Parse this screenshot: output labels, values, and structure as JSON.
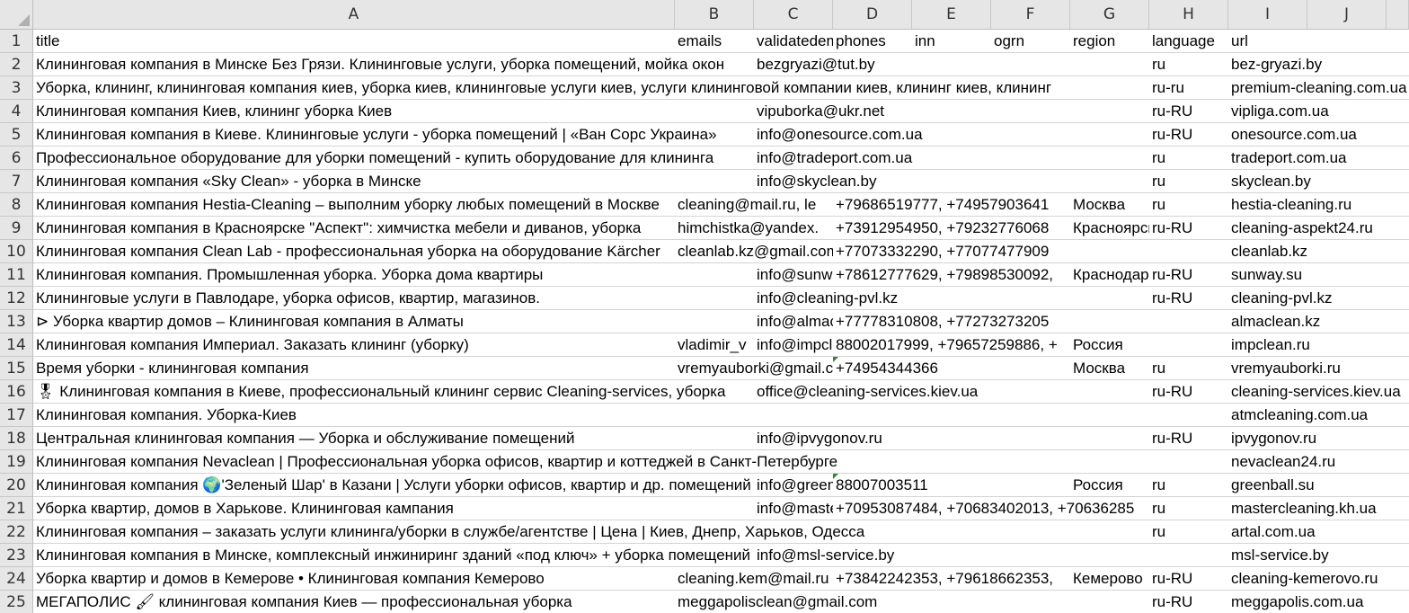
{
  "columns": [
    "A",
    "B",
    "C",
    "D",
    "E",
    "F",
    "G",
    "H",
    "I",
    "J"
  ],
  "rows": [
    [
      "title",
      "emails",
      "validatedemails",
      "phones",
      "inn",
      "ogrn",
      "region",
      "language",
      "url",
      ""
    ],
    [
      "Клининговая компания в Минске Без Грязи. Клининговые услуги, уборка помещений, мойка окон",
      "",
      "bezgryazi@tut.by",
      "",
      "",
      "",
      "",
      "ru",
      "bez-gryazi.by",
      ""
    ],
    [
      "Уборка, клининг, клининговая компания киев, уборка киев, клининговые услуги киев, услуги клининговой компании киев, клининг киев, клининг",
      "",
      "",
      "",
      "",
      "",
      "",
      "ru-ru",
      "premium-cleaning.com.ua",
      ""
    ],
    [
      "Клининговая компания Киев, клининг уборка Киев",
      "",
      "vipuborka@ukr.net",
      "",
      "",
      "",
      "",
      "ru-RU",
      "vipliga.com.ua",
      ""
    ],
    [
      "Клининговая компания в Киеве. Клининговые услуги - уборка помещений | «Ван Сорс Украина»",
      "",
      "info@onesource.com.ua",
      "",
      "",
      "",
      "",
      "ru-RU",
      "onesource.com.ua",
      ""
    ],
    [
      "Профессиональное оборудование для уборки помещений - купить оборудование для клининга",
      "",
      "info@tradeport.com.ua",
      "",
      "",
      "",
      "",
      "ru",
      "tradeport.com.ua",
      ""
    ],
    [
      "Клининговая компания «Sky Clean» - уборка в Минске",
      "",
      "info@skyclean.by",
      "",
      "",
      "",
      "",
      "ru",
      "skyclean.by",
      ""
    ],
    [
      "Клининговая компания Hestia-Cleaning – выполним уборку любых помещений в Москве",
      "cleaning@mail.ru, le",
      "",
      "+79686519777, +74957903641",
      "",
      "",
      "Москва",
      "ru",
      "hestia-cleaning.ru",
      ""
    ],
    [
      "Клининговая компания в Красноярске \"Аспект\": химчистка мебели и диванов, уборка",
      "himchistka@yandex.",
      "",
      "+73912954950, +79232776068",
      "",
      "",
      "Красноярск",
      "ru-RU",
      "cleaning-aspekt24.ru",
      ""
    ],
    [
      "Клининговая компания Clean Lab - профессиональная уборка на оборудование Kärcher",
      "cleanlab.kz@gmail.com",
      "",
      "+77073332290, +77077477909",
      "",
      "",
      "",
      "",
      "cleanlab.kz",
      ""
    ],
    [
      "Клининговая компания. Промышленная уборка. Уборка дома квартиры",
      "",
      "info@sunway.su",
      "+78612777629, +79898530092,",
      "",
      "",
      "Краснодар",
      "ru-RU",
      "sunway.su",
      ""
    ],
    [
      "Клининговые услуги в Павлодаре, уборка офисов, квартир, магазинов.",
      "",
      "info@cleaning-pvl.kz",
      "",
      "",
      "",
      "",
      "ru-RU",
      "cleaning-pvl.kz",
      ""
    ],
    [
      "⊳ Уборка квартир домов – Клининговая компания в Алматы",
      "",
      "info@almaclean.kz",
      "+77778310808, +77273273205",
      "",
      "",
      "",
      "",
      "almaclean.kz",
      ""
    ],
    [
      "Клининговая компания Империал. Заказать клининг (уборку)",
      "vladimir_v",
      "info@impclean.ru",
      "88002017999, +79657259886, +",
      "",
      "",
      "Россия",
      "",
      "impclean.ru",
      ""
    ],
    [
      "Время уборки - клининговая компания",
      "vremyauborki@gmail.com",
      "",
      "+74954344366",
      "",
      "",
      "Москва",
      "ru",
      "vremyauborki.ru",
      ""
    ],
    [
      "🎖 Клининговая компания в Киеве, профессиональный клининг сервис Cleaning-services, уборка",
      "",
      "office@cleaning-services.kiev.ua",
      "",
      "",
      "",
      "",
      "ru-RU",
      "cleaning-services.kiev.ua",
      ""
    ],
    [
      "Клининговая компания. Уборка-Киев",
      "",
      "",
      "",
      "",
      "",
      "",
      "",
      "atmcleaning.com.ua",
      ""
    ],
    [
      "Центральная клининговая компания — Уборка и обслуживание помещений",
      "",
      "info@ipvygonov.ru",
      "",
      "",
      "",
      "",
      "ru-RU",
      "ipvygonov.ru",
      ""
    ],
    [
      "Клининговая компания Nevaclean | Профессиональная уборка офисов, квартир и коттеджей в Санкт-Петербурге",
      "",
      "",
      "",
      "",
      "",
      "",
      "",
      "nevaclean24.ru",
      ""
    ],
    [
      "Клининговая компания 🌍'Зеленый Шар' в Казани | Услуги уборки офисов, квартир и др. помещений",
      "",
      "info@greenball.su",
      "88007003511",
      "",
      "",
      "Россия",
      "ru",
      "greenball.su",
      ""
    ],
    [
      "Уборка квартир, домов в Харькове. Клининговая кампания",
      "",
      "info@mastercleaning.kh.ua",
      "+70953087484, +70683402013, +70636285",
      "",
      "",
      "",
      "ru",
      "mastercleaning.kh.ua",
      ""
    ],
    [
      "Клининговая компания – заказать услуги клининга/уборки в службе/агентстве | Цена | Киев, Днепр, Харьков, Одесса",
      "",
      "",
      "",
      "",
      "",
      "",
      "ru",
      "artal.com.ua",
      ""
    ],
    [
      "Клининговая компания в Минске, комплексный инжиниринг зданий «под ключ» + уборка помещений",
      "",
      "info@msl-service.by",
      "",
      "",
      "",
      "",
      "",
      "msl-service.by",
      ""
    ],
    [
      "Уборка квартир и домов в Кемерове • Клининговая компания Кемерово",
      "cleaning.kem@mail.ru",
      "",
      "+73842242353, +79618662353,",
      "",
      "",
      "Кемерово",
      "ru-RU",
      "cleaning-kemerovo.ru",
      ""
    ],
    [
      "МЕГАПОЛИС 🖌 клининговая компания Киев — профессиональная уборка",
      "meggapolisclean@gmail.com",
      "",
      "",
      "",
      "",
      "",
      "ru-RU",
      "meggapolis.com.ua",
      ""
    ]
  ]
}
